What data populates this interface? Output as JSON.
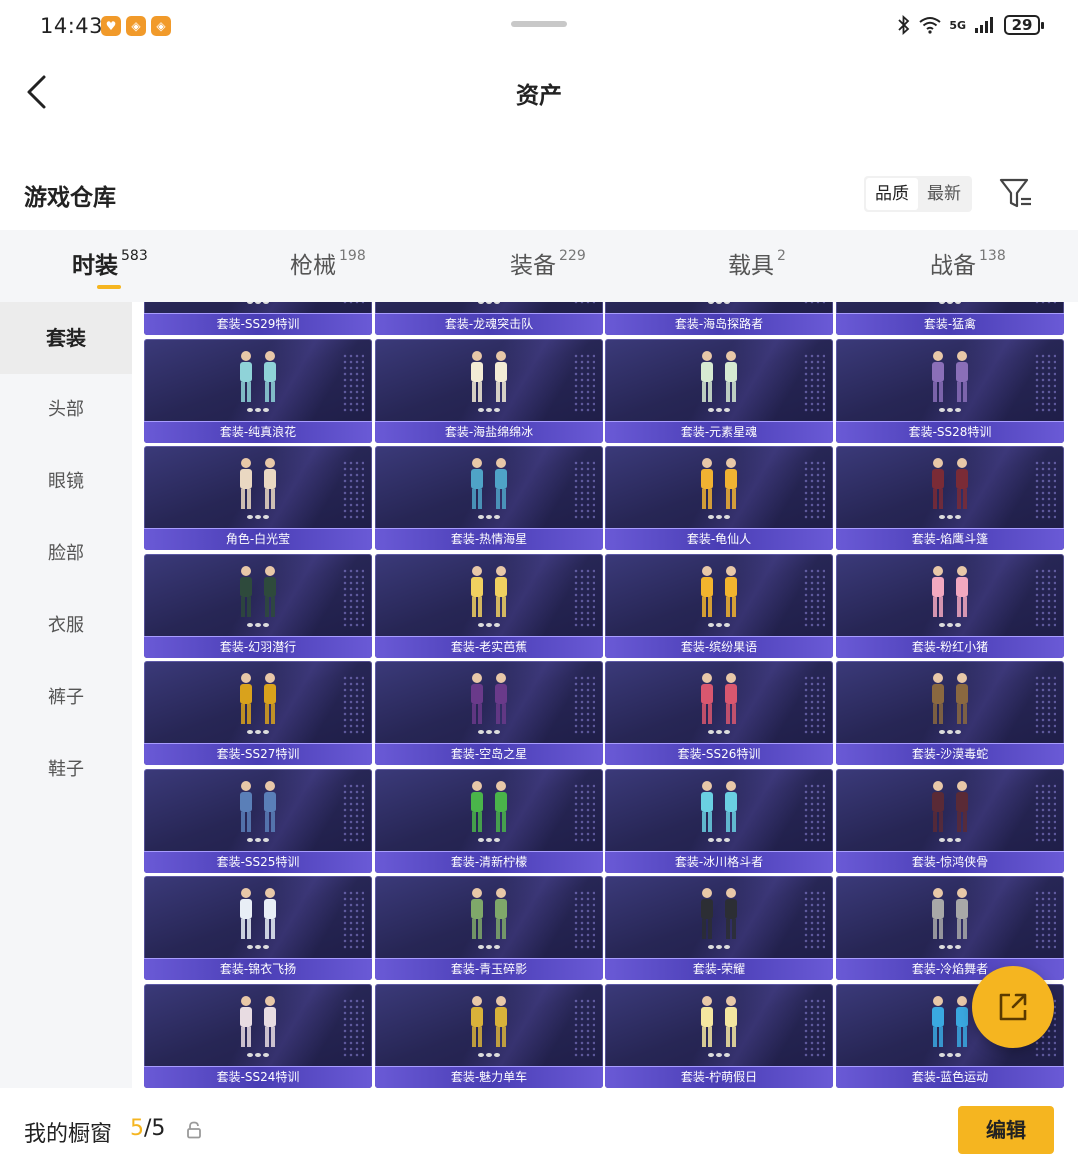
{
  "status_bar": {
    "time": "14:43",
    "network": "5G",
    "battery": "29",
    "app_icons": [
      "notification-app-icon",
      "notification-app-icon",
      "notification-app-icon"
    ]
  },
  "header": {
    "title": "资产",
    "back_icon": "chevron-left-icon"
  },
  "warehouse": {
    "title": "游戏仓库",
    "sort_options": [
      {
        "label": "品质",
        "active": true
      },
      {
        "label": "最新",
        "active": false
      }
    ],
    "filter_icon": "filter-icon"
  },
  "tabs": [
    {
      "label": "时装",
      "count": "583",
      "active": true
    },
    {
      "label": "枪械",
      "count": "198",
      "active": false
    },
    {
      "label": "装备",
      "count": "229",
      "active": false
    },
    {
      "label": "载具",
      "count": "2",
      "active": false
    },
    {
      "label": "战备",
      "count": "138",
      "active": false
    }
  ],
  "sidebar": {
    "items": [
      {
        "label": "套装",
        "active": true
      },
      {
        "label": "头部",
        "active": false
      },
      {
        "label": "眼镜",
        "active": false
      },
      {
        "label": "脸部",
        "active": false
      },
      {
        "label": "衣服",
        "active": false
      },
      {
        "label": "裤子",
        "active": false
      },
      {
        "label": "鞋子",
        "active": false
      }
    ]
  },
  "items": [
    {
      "name": "套装-SS29特训",
      "color": "#d9d3c4"
    },
    {
      "name": "套装-龙魂突击队",
      "color": "#3a3a3a"
    },
    {
      "name": "套装-海岛探路者",
      "color": "#8a8f88"
    },
    {
      "name": "套装-猛禽",
      "color": "#c9c2b0"
    },
    {
      "name": "套装-纯真浪花",
      "color": "#8fd3d8"
    },
    {
      "name": "套装-海盐绵绵冰",
      "color": "#f3ecd6"
    },
    {
      "name": "套装-元素星魂",
      "color": "#d6ead2"
    },
    {
      "name": "套装-SS28特训",
      "color": "#8a6fb8"
    },
    {
      "name": "角色-白光莹",
      "color": "#ead8c2"
    },
    {
      "name": "套装-热情海星",
      "color": "#4fa3c7"
    },
    {
      "name": "套装-龟仙人",
      "color": "#f0b232"
    },
    {
      "name": "套装-焰鹰斗篷",
      "color": "#7a2b36"
    },
    {
      "name": "套装-幻羽潜行",
      "color": "#2e4a3c"
    },
    {
      "name": "套装-老实芭蕉",
      "color": "#f0d060"
    },
    {
      "name": "套装-缤纷果语",
      "color": "#f2b42e"
    },
    {
      "name": "套装-粉红小猪",
      "color": "#f2a8c0"
    },
    {
      "name": "套装-SS27特训",
      "color": "#d9a21c"
    },
    {
      "name": "套装-空岛之星",
      "color": "#6a3a8a"
    },
    {
      "name": "套装-SS26特训",
      "color": "#d9576f"
    },
    {
      "name": "套装-沙漠毒蛇",
      "color": "#8a6840"
    },
    {
      "name": "套装-SS25特训",
      "color": "#5a7fb8"
    },
    {
      "name": "套装-清新柠檬",
      "color": "#4ab44a"
    },
    {
      "name": "套装-冰川格斗者",
      "color": "#6ad0e2"
    },
    {
      "name": "套装-惊鸿侠骨",
      "color": "#5a2a36"
    },
    {
      "name": "套装-锦衣飞扬",
      "color": "#e8eef6"
    },
    {
      "name": "套装-青玉碎影",
      "color": "#7fa86a"
    },
    {
      "name": "套装-荣耀",
      "color": "#2c2e34"
    },
    {
      "name": "套装-冷焰舞者",
      "color": "#a8a8a8"
    },
    {
      "name": "套装-SS24特训",
      "color": "#e8dce2"
    },
    {
      "name": "套装-魅力单车",
      "color": "#d8b23a"
    },
    {
      "name": "套装-柠萌假日",
      "color": "#f4e6a0"
    },
    {
      "name": "套装-蓝色运动",
      "color": "#3aa8e0"
    }
  ],
  "fab": {
    "icon": "share-external-icon"
  },
  "showcase": {
    "label": "我的橱窗",
    "current": "5",
    "separator": "/",
    "total": "5",
    "lock_icon": "lock-icon"
  },
  "edit_button": {
    "label": "编辑"
  },
  "colors": {
    "accent": "#f5b520",
    "card_bg": "#272655",
    "card_bar": "#5a4ac8"
  }
}
